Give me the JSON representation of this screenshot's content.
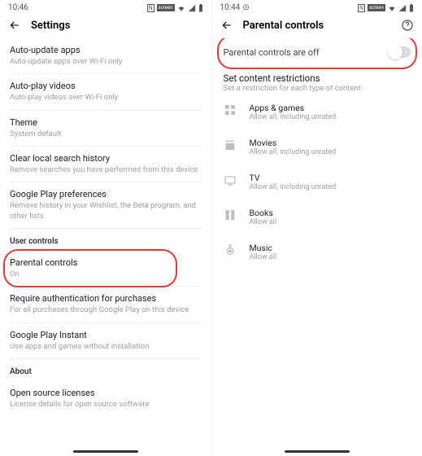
{
  "left": {
    "status_time": "10:46",
    "title": "Settings",
    "items": [
      {
        "primary": "Auto-update apps",
        "secondary": "Auto-update apps over Wi-Fi only"
      },
      {
        "primary": "Auto-play videos",
        "secondary": "Auto-play videos over Wi-Fi only"
      },
      {
        "primary": "Theme",
        "secondary": "System default"
      },
      {
        "primary": "Clear local search history",
        "secondary": "Remove searches you have performed from this device"
      },
      {
        "primary": "Google Play preferences",
        "secondary": "Remove history in your Wishlist, the Beta program, and other lists"
      }
    ],
    "section_user": "User controls",
    "parental": {
      "primary": "Parental controls",
      "secondary": "On"
    },
    "items2": [
      {
        "primary": "Require authentication for purchases",
        "secondary": "For all purchases through Google Play on this device"
      },
      {
        "primary": "Google Play Instant",
        "secondary": "Use apps and games without installation"
      }
    ],
    "section_about": "About",
    "about_item": {
      "primary": "Open source licenses",
      "secondary": "License details for open source software"
    }
  },
  "right": {
    "status_time": "10:44",
    "title": "Parental controls",
    "toggle_label": "Parental controls are off",
    "restrict_head": "Set content restrictions",
    "restrict_sub": "Set a restriction for each type of content",
    "cats": [
      {
        "primary": "Apps & games",
        "secondary": "Allow all, including unrated",
        "icon": "apps"
      },
      {
        "primary": "Movies",
        "secondary": "Allow all, including unrated",
        "icon": "movies"
      },
      {
        "primary": "TV",
        "secondary": "Allow all, including unrated",
        "icon": "tv"
      },
      {
        "primary": "Books",
        "secondary": "Allow all",
        "icon": "books"
      },
      {
        "primary": "Music",
        "secondary": "Allow all",
        "icon": "music"
      }
    ]
  }
}
